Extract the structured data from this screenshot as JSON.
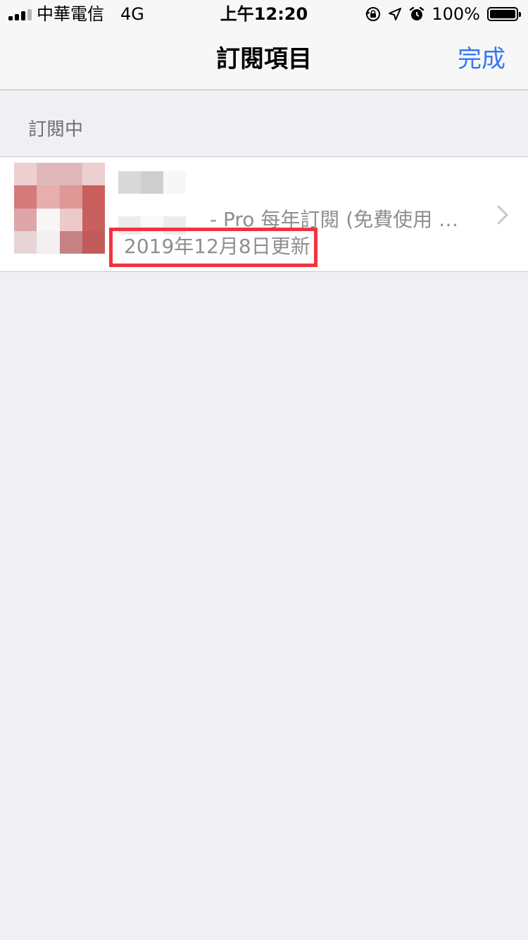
{
  "status_bar": {
    "carrier": "中華電信",
    "network": "4G",
    "time": "上午12:20",
    "battery_percent": "100%",
    "battery_level": 1.0,
    "icons": [
      "signal-bars-icon",
      "rotation-lock-icon",
      "location-arrow-icon",
      "alarm-clock-icon",
      "battery-icon"
    ]
  },
  "nav": {
    "title": "訂閱項目",
    "done_label": "完成"
  },
  "section": {
    "header": "訂閱中"
  },
  "subscription": {
    "description": "- Pro 每年訂閱 (免費使用 …",
    "updated": "2019年12月8日更新"
  },
  "colors": {
    "accent": "#3478f6",
    "highlight": "#f0343f",
    "secondary_text": "#8e8e93",
    "background": "#efeff4"
  }
}
